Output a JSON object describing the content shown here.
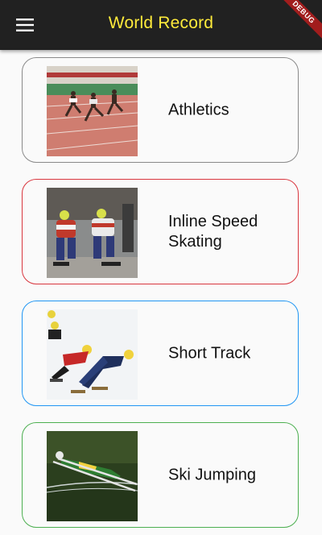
{
  "appbar": {
    "title": "World Record",
    "menu_icon": "hamburger-menu-icon",
    "debug_banner": "DEBUG",
    "background": "#212121",
    "title_color": "#ffeb3b"
  },
  "sports": [
    {
      "name": "Athletics",
      "border_color": "#8a8a8a"
    },
    {
      "name": "Inline Speed Skating",
      "border_color": "#d9363e"
    },
    {
      "name": "Short Track",
      "border_color": "#2196f3"
    },
    {
      "name": "Ski Jumping",
      "border_color": "#4caf50"
    }
  ]
}
